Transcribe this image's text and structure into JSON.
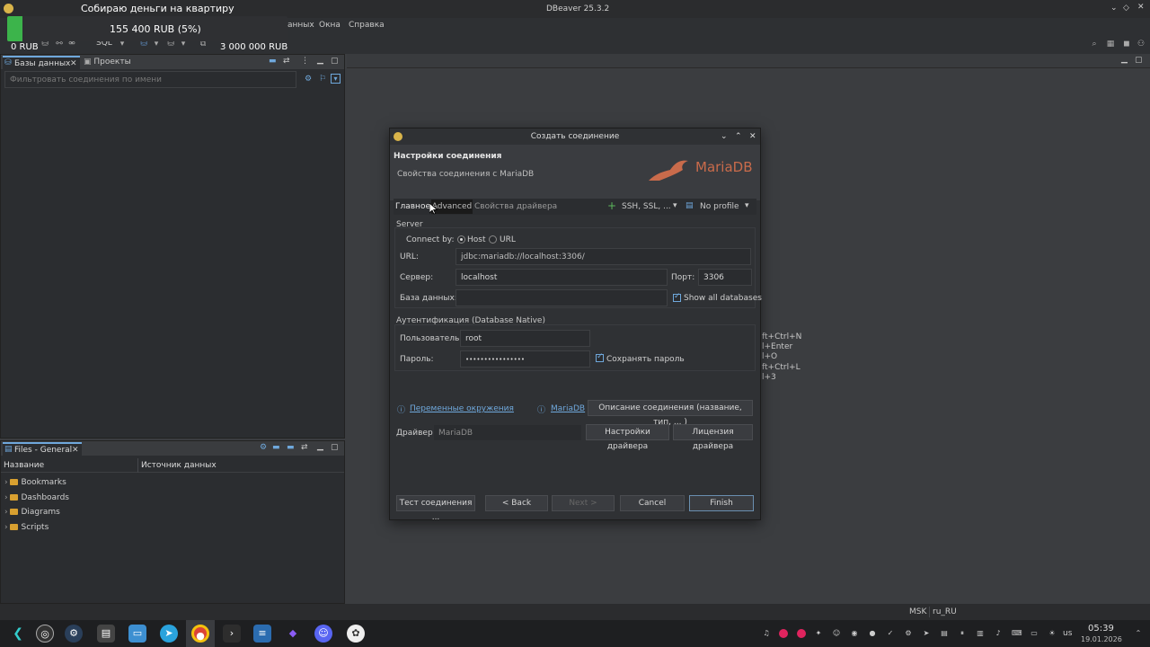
{
  "window": {
    "title": "DBeaver 25.3.2"
  },
  "donation": {
    "title": "Собираю деньги на квартиру",
    "progress_text": "155 400 RUB (5%)",
    "start": "0 RUB",
    "goal": "3 000 000 RUB",
    "progress": 0.05
  },
  "menu": {
    "items_visible": [
      "анных",
      "Окна",
      "Справка"
    ]
  },
  "toolbar": {
    "sql_label": "SQL"
  },
  "db_panel": {
    "tabs": [
      "Базы данных",
      "Проекты"
    ],
    "filter_placeholder": "Фильтровать соединения по имени"
  },
  "files_panel": {
    "tab": "Files - General",
    "columns": [
      "Название",
      "Источник данных"
    ],
    "items": [
      "Bookmarks",
      "Dashboards",
      "Diagrams",
      "Scripts"
    ]
  },
  "editor_hints": [
    "ft+Ctrl+N",
    "l+Enter",
    "l+O",
    "ft+Ctrl+L",
    "l+3"
  ],
  "dialog": {
    "title": "Создать соединение",
    "header_title": "Настройки соединения",
    "header_subtitle": "Свойства соединения с MariaDB",
    "brand": "MariaDB",
    "tabs": [
      "Главное",
      "Advanced",
      "Свойства драйвера"
    ],
    "ssh_label": "SSH, SSL, ...",
    "profile_label": "No profile",
    "server_group": "Server",
    "connect_by_label": "Connect by:",
    "connect_host": "Host",
    "connect_url": "URL",
    "url_label": "URL:",
    "url_value": "jdbc:mariadb://localhost:3306/",
    "server_label": "Сервер:",
    "server_value": "localhost",
    "port_label": "Порт:",
    "port_value": "3306",
    "db_label": "База данных:",
    "db_value": "",
    "show_all_label": "Show all databases",
    "auth_group": "Аутентификация (Database Native)",
    "user_label": "Пользователь:",
    "user_value": "root",
    "password_label": "Пароль:",
    "password_value": "••••••••••••••••",
    "save_password_label": "Сохранять пароль",
    "env_link": "Переменные окружения",
    "mariadb_link": "MariaDB",
    "description_button": "Описание соединения (название, тип, ... )",
    "driver_label": "Драйвер:",
    "driver_value": "MariaDB",
    "driver_settings_button": "Настройки драйвера",
    "driver_license_button": "Лицензия драйвера",
    "test_button": "Тест соединения ...",
    "back_button": "< Back",
    "next_button": "Next >",
    "cancel_button": "Cancel",
    "finish_button": "Finish"
  },
  "statusbar": {
    "tz": "MSK",
    "locale": "ru_RU"
  },
  "clock": {
    "time": "05:39",
    "date": "19.01.2026"
  },
  "tray": {
    "layout": "us"
  },
  "colors": {
    "accent": "#6fa8dc",
    "brand": "#c96b4b",
    "progress": "#3cb44b"
  }
}
